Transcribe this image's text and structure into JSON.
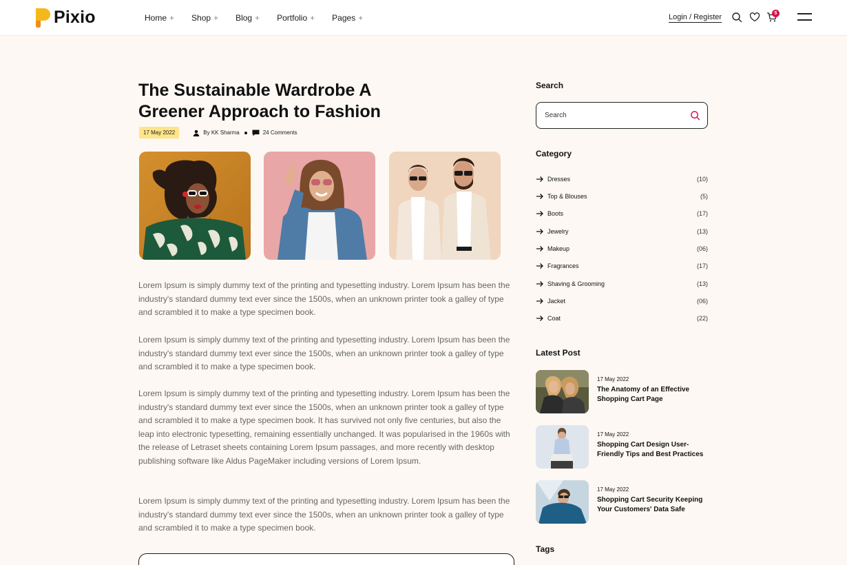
{
  "header": {
    "logo_text": "Pixio",
    "nav": [
      {
        "label": "Home",
        "plus": "+"
      },
      {
        "label": "Shop",
        "plus": "+"
      },
      {
        "label": "Blog",
        "plus": "+"
      },
      {
        "label": "Portfolio",
        "plus": "+"
      },
      {
        "label": "Pages",
        "plus": "+"
      }
    ],
    "login_label": "Login / Register",
    "cart_count": "5",
    "accent_color": "#d6124b"
  },
  "post": {
    "title": "The Sustainable Wardrobe A Greener Approach to Fashion",
    "date": "17 May 2022",
    "author": "By KK Sharma",
    "comments": "24 Comments",
    "paragraphs": [
      "Lorem Ipsum is simply dummy text of the printing and typesetting industry. Lorem Ipsum has been the industry's standard dummy text ever since the 1500s, when an unknown printer took a galley of type and scrambled it to make a type specimen book.",
      "Lorem Ipsum is simply dummy text of the printing and typesetting industry. Lorem Ipsum has been the industry's standard dummy text ever since the 1500s, when an unknown printer took a galley of type and scrambled it to make a type specimen book.",
      "Lorem Ipsum is simply dummy text of the printing and typesetting industry. Lorem Ipsum has been the industry's standard dummy text ever since the 1500s, when an unknown printer took a galley of type and scrambled it to make a type specimen book. It has survived not only five centuries, but also the leap into electronic typesetting, remaining essentially unchanged. It was popularised in the 1960s with the release of Letraset sheets containing Lorem Ipsum passages, and more recently with desktop publishing software like Aldus PageMaker including versions of Lorem Ipsum.",
      "Lorem Ipsum is simply dummy text of the printing and typesetting industry. Lorem Ipsum has been the industry's standard dummy text ever since the 1500s, when an unknown printer took a galley of type and scrambled it to make a type specimen book."
    ]
  },
  "sidebar": {
    "search_heading": "Search",
    "search_placeholder": "Search",
    "category_heading": "Category",
    "categories": [
      {
        "label": "Dresses",
        "count": "(10)"
      },
      {
        "label": "Top & Blouses",
        "count": "(5)"
      },
      {
        "label": "Boots",
        "count": "(17)"
      },
      {
        "label": "Jewelry",
        "count": "(13)"
      },
      {
        "label": "Makeup",
        "count": "(06)"
      },
      {
        "label": "Fragrances",
        "count": "(17)"
      },
      {
        "label": "Shaving & Grooming",
        "count": "(13)"
      },
      {
        "label": "Jacket",
        "count": "(06)"
      },
      {
        "label": "Coat",
        "count": "(22)"
      }
    ],
    "latest_heading": "Latest Post",
    "latest_posts": [
      {
        "date": "17 May 2022",
        "title": "The Anatomy of an Effective Shopping Cart Page"
      },
      {
        "date": "17 May 2022",
        "title": "Shopping Cart Design User-Friendly Tips and Best Practices"
      },
      {
        "date": "17 May 2022",
        "title": "Shopping Cart Security Keeping Your Customers' Data Safe"
      }
    ],
    "tags_heading": "Tags"
  }
}
